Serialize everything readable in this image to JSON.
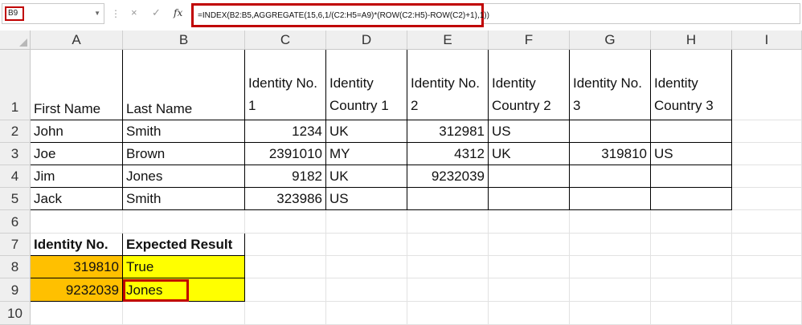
{
  "formula_bar": {
    "name_box": "B9",
    "cancel_icon": "×",
    "enter_icon": "✓",
    "fx_label": "fx",
    "formula": "=INDEX(B2:B5,AGGREGATE(15,6,1/(C2:H5=A9)*(ROW(C2:H5)-ROW(C2)+1),1))"
  },
  "columns": [
    "A",
    "B",
    "C",
    "D",
    "E",
    "F",
    "G",
    "H",
    "I"
  ],
  "rows": [
    "1",
    "2",
    "3",
    "4",
    "5",
    "6",
    "7",
    "8",
    "9",
    "10"
  ],
  "table": {
    "headers": [
      "First Name",
      "Last Name",
      "Identity No. 1",
      "Identity Country 1",
      "Identity No. 2",
      "Identity Country 2",
      "Identity No. 3",
      "Identity Country 3"
    ],
    "data": [
      [
        "John",
        "Smith",
        "1234",
        "UK",
        "312981",
        "US",
        "",
        ""
      ],
      [
        "Joe",
        "Brown",
        "2391010",
        "MY",
        "4312",
        "UK",
        "319810",
        "US"
      ],
      [
        "Jim",
        "Jones",
        "9182",
        "UK",
        "9232039",
        "",
        "",
        ""
      ],
      [
        "Jack",
        "Smith",
        "323986",
        "US",
        "",
        "",
        "",
        ""
      ]
    ]
  },
  "lookup": {
    "header_a": "Identity No.",
    "header_b": "Expected Result",
    "row8": [
      "319810",
      "True"
    ],
    "row9": [
      "9232039",
      "Jones"
    ]
  },
  "colors": {
    "highlight_border": "#c00000",
    "orange_fill": "#ffc000",
    "yellow_fill": "#ffff00"
  }
}
